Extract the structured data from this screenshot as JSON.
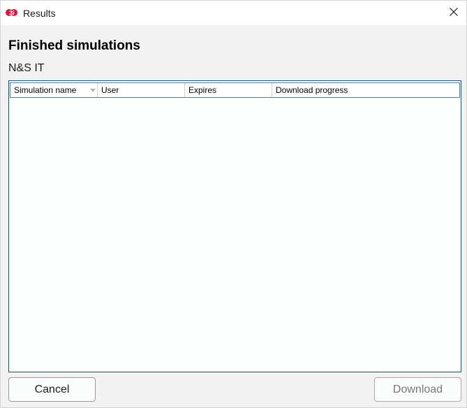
{
  "window": {
    "title": "Results",
    "icon": "app-logo-icon",
    "close_icon": "close-icon"
  },
  "header": {
    "title": "Finished simulations",
    "subtitle": "N&S IT"
  },
  "table": {
    "columns": [
      {
        "label": "Simulation name",
        "sorted": true
      },
      {
        "label": "User"
      },
      {
        "label": "Expires"
      },
      {
        "label": "Download progress"
      }
    ],
    "rows": []
  },
  "buttons": {
    "cancel_label": "Cancel",
    "download_label": "Download",
    "download_enabled": false
  },
  "colors": {
    "accent": "#d8143c",
    "list_border": "#1f4d6a"
  }
}
